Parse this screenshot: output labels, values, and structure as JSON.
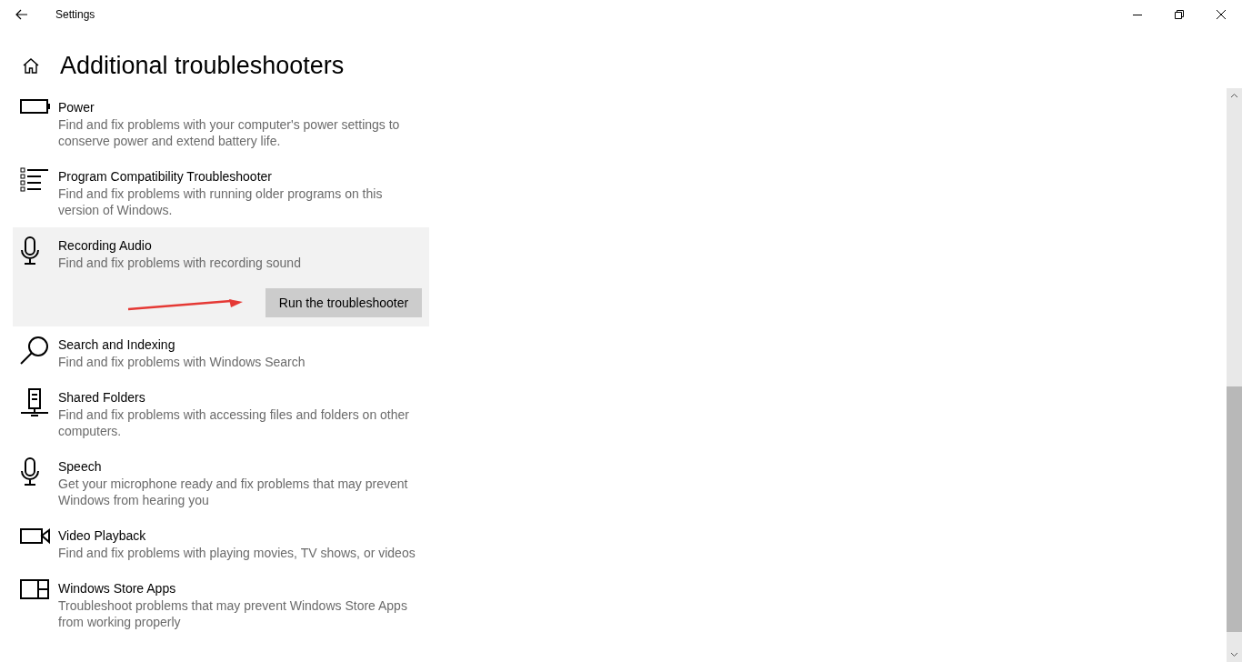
{
  "window": {
    "title": "Settings"
  },
  "page": {
    "title": "Additional troubleshooters"
  },
  "items": [
    {
      "kind": "battery",
      "title": "Power",
      "description": "Find and fix problems with your computer's power settings to conserve power and extend battery life.",
      "expanded": false
    },
    {
      "kind": "list",
      "title": "Program Compatibility Troubleshooter",
      "description": "Find and fix problems with running older programs on this version of Windows.",
      "expanded": false
    },
    {
      "kind": "microphone",
      "title": "Recording Audio",
      "description": "Find and fix problems with recording sound",
      "expanded": true,
      "button": "Run the troubleshooter"
    },
    {
      "kind": "search",
      "title": "Search and Indexing",
      "description": "Find and fix problems with Windows Search",
      "expanded": false
    },
    {
      "kind": "server",
      "title": "Shared Folders",
      "description": "Find and fix problems with accessing files and folders on other computers.",
      "expanded": false
    },
    {
      "kind": "microphone",
      "title": "Speech",
      "description": "Get your microphone ready and fix problems that may prevent Windows from hearing you",
      "expanded": false
    },
    {
      "kind": "camera",
      "title": "Video Playback",
      "description": "Find and fix problems with playing movies, TV shows, or videos",
      "expanded": false
    },
    {
      "kind": "store",
      "title": "Windows Store Apps",
      "description": "Troubleshoot problems that may prevent Windows Store Apps from working properly",
      "expanded": false
    }
  ]
}
